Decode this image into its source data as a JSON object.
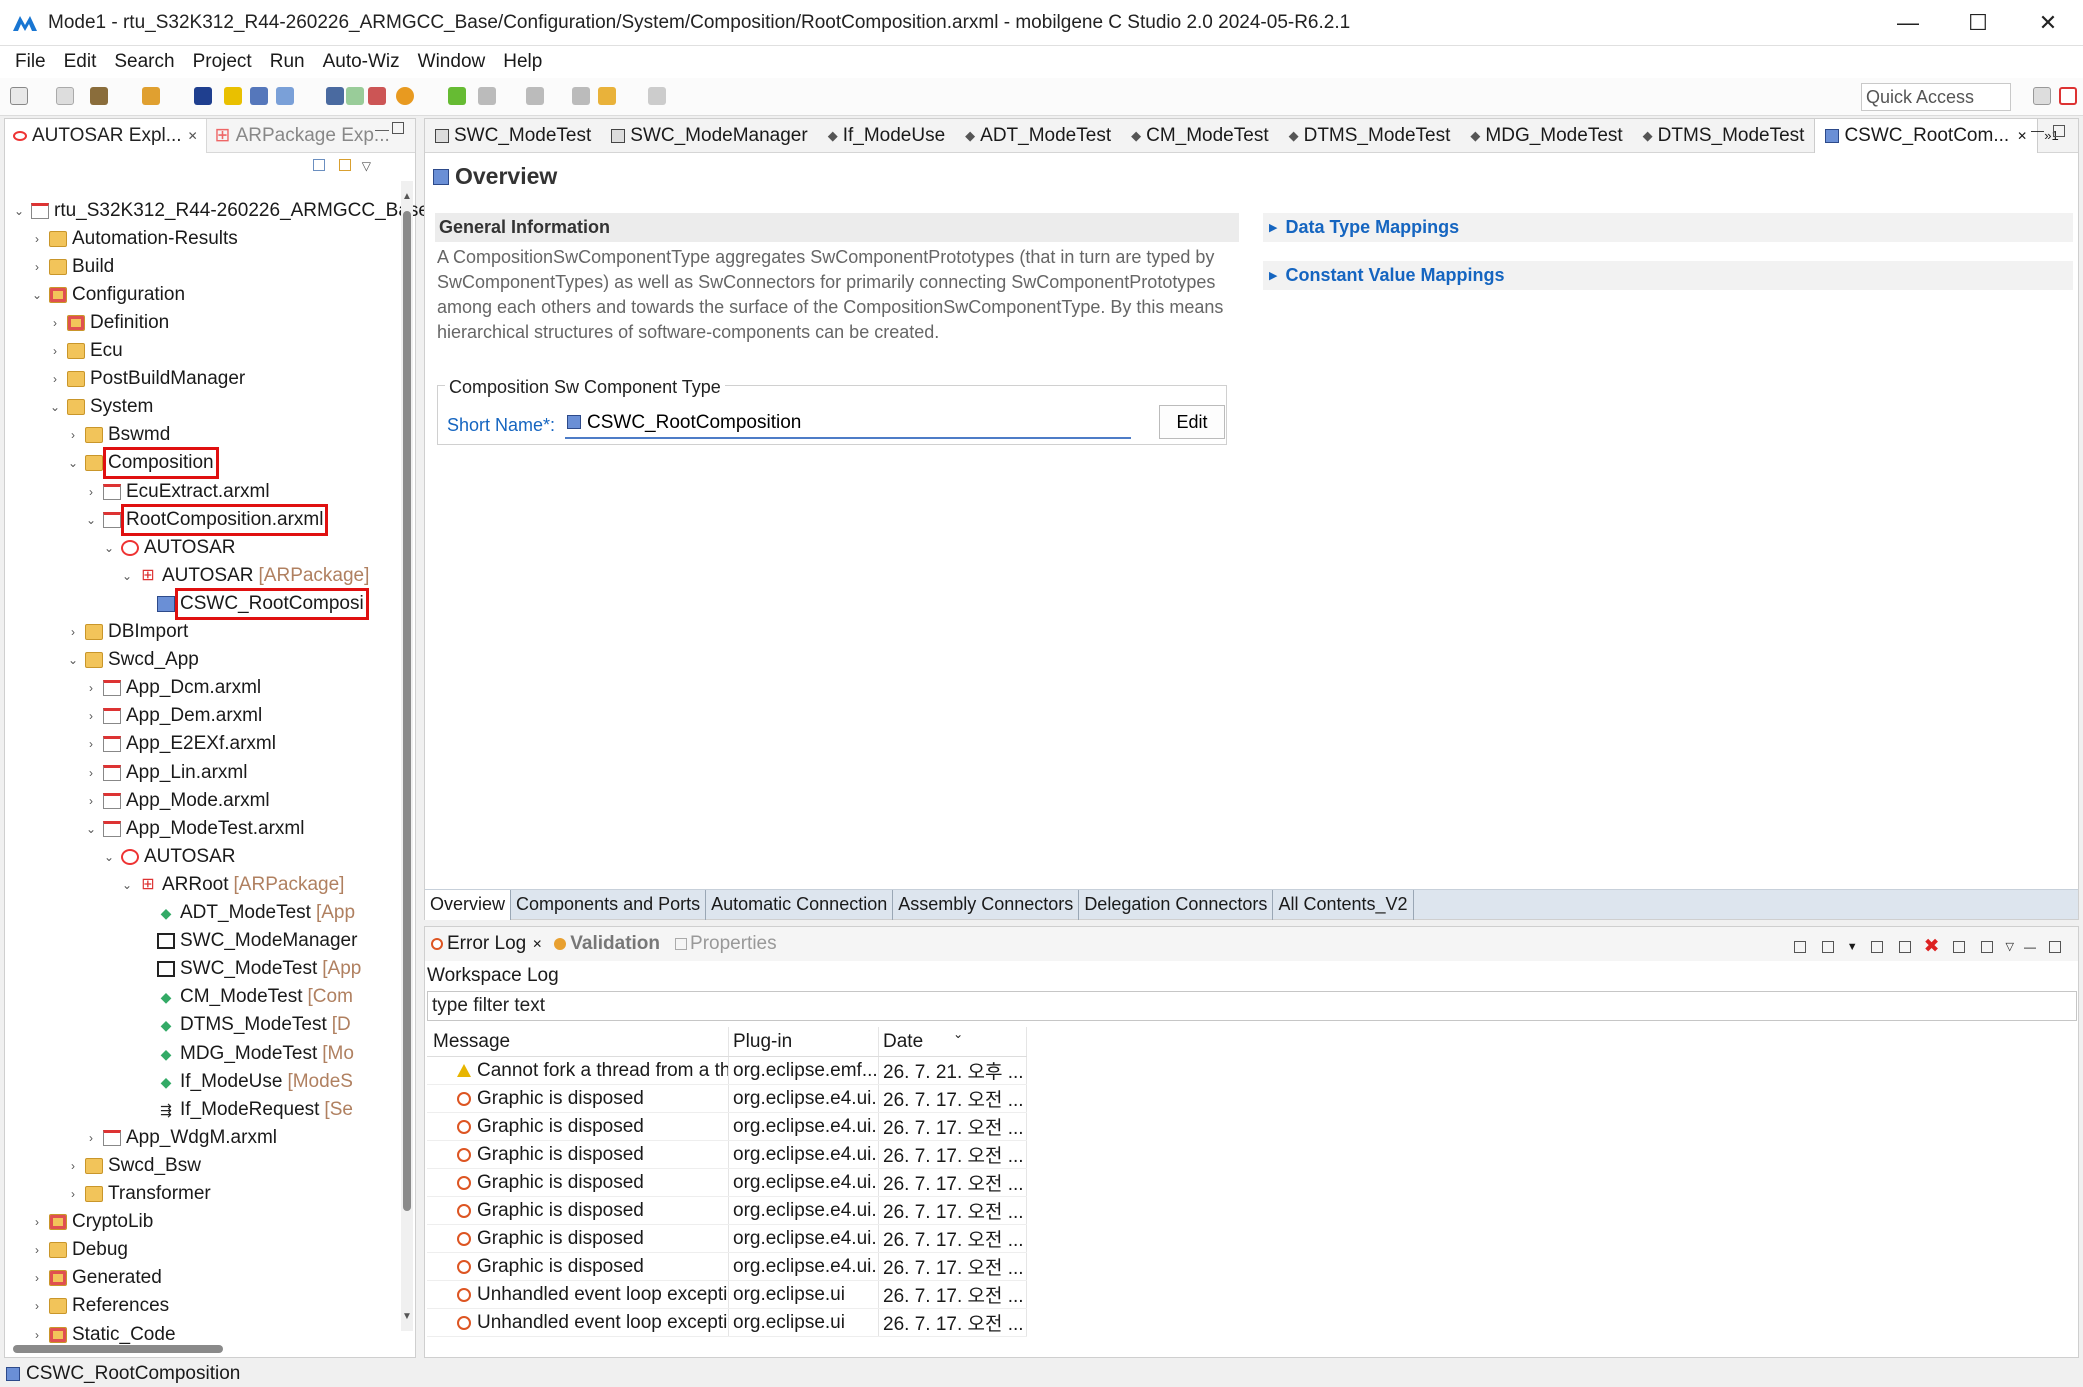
{
  "window": {
    "title": "Mode1 - rtu_S32K312_R44-260226_ARMGCC_Base/Configuration/System/Composition/RootComposition.arxml - mobilgene C Studio 2.0 2024-05-R6.2.1",
    "minimize": "—",
    "maximize": "☐",
    "close": "✕"
  },
  "menu": [
    "File",
    "Edit",
    "Search",
    "Project",
    "Run",
    "Auto-Wiz",
    "Window",
    "Help"
  ],
  "toolbar": {
    "quick_access": "Quick Access"
  },
  "left_panel": {
    "tabs": [
      {
        "label": "AUTOSAR Expl...",
        "active": true
      },
      {
        "label": "ARPackage Exp...",
        "active": false
      }
    ],
    "tree": [
      {
        "label": "rtu_S32K312_R44-260226_ARMGCC_Base",
        "depth": 0,
        "arrow": "⌄",
        "icon": "project-icon"
      },
      {
        "label": "Automation-Results",
        "depth": 1,
        "arrow": "›",
        "icon": "folder-icon"
      },
      {
        "label": "Build",
        "depth": 1,
        "arrow": "›",
        "icon": "folder-icon"
      },
      {
        "label": "Configuration",
        "depth": 1,
        "arrow": "⌄",
        "icon": "folder-red-icon"
      },
      {
        "label": "Definition",
        "depth": 2,
        "arrow": "›",
        "icon": "folder-red-icon"
      },
      {
        "label": "Ecu",
        "depth": 2,
        "arrow": "›",
        "icon": "folder-icon"
      },
      {
        "label": "PostBuildManager",
        "depth": 2,
        "arrow": "›",
        "icon": "folder-icon"
      },
      {
        "label": "System",
        "depth": 2,
        "arrow": "⌄",
        "icon": "folder-icon"
      },
      {
        "label": "Bswmd",
        "depth": 3,
        "arrow": "›",
        "icon": "folder-icon"
      },
      {
        "label": "Composition",
        "depth": 3,
        "arrow": "⌄",
        "icon": "folder-icon",
        "highlight": true
      },
      {
        "label": "EcuExtract.arxml",
        "depth": 4,
        "arrow": "›",
        "icon": "file-icon"
      },
      {
        "label": "RootComposition.arxml",
        "depth": 4,
        "arrow": "⌄",
        "icon": "file-icon",
        "highlight": true
      },
      {
        "label": "AUTOSAR",
        "depth": 5,
        "arrow": "⌄",
        "icon": "autosar-icon"
      },
      {
        "label": "AUTOSAR",
        "suffix": "[ARPackage]",
        "depth": 6,
        "arrow": "⌄",
        "icon": "package-icon"
      },
      {
        "label": "CSWC_RootComposi",
        "depth": 7,
        "arrow": "",
        "icon": "composition-icon",
        "highlight": true
      },
      {
        "label": "DBImport",
        "depth": 3,
        "arrow": "›",
        "icon": "folder-icon"
      },
      {
        "label": "Swcd_App",
        "depth": 3,
        "arrow": "⌄",
        "icon": "folder-icon"
      },
      {
        "label": "App_Dcm.arxml",
        "depth": 4,
        "arrow": "›",
        "icon": "file-icon"
      },
      {
        "label": "App_Dem.arxml",
        "depth": 4,
        "arrow": "›",
        "icon": "file-icon"
      },
      {
        "label": "App_E2EXf.arxml",
        "depth": 4,
        "arrow": "›",
        "icon": "file-icon"
      },
      {
        "label": "App_Lin.arxml",
        "depth": 4,
        "arrow": "›",
        "icon": "file-icon"
      },
      {
        "label": "App_Mode.arxml",
        "depth": 4,
        "arrow": "›",
        "icon": "file-icon"
      },
      {
        "label": "App_ModeTest.arxml",
        "depth": 4,
        "arrow": "⌄",
        "icon": "file-icon"
      },
      {
        "label": "AUTOSAR",
        "depth": 5,
        "arrow": "⌄",
        "icon": "autosar-icon"
      },
      {
        "label": "ARRoot",
        "suffix": "[ARPackage]",
        "depth": 6,
        "arrow": "⌄",
        "icon": "package-icon"
      },
      {
        "label": "ADT_ModeTest",
        "suffix": "[App",
        "depth": 7,
        "arrow": "",
        "icon": "port-icon"
      },
      {
        "label": "SWC_ModeManager",
        "depth": 7,
        "arrow": "",
        "icon": "swc-icon"
      },
      {
        "label": "SWC_ModeTest",
        "suffix": "[App",
        "depth": 7,
        "arrow": "",
        "icon": "swc-icon"
      },
      {
        "label": "CM_ModeTest",
        "suffix": "[Com",
        "depth": 7,
        "arrow": "",
        "icon": "port-icon"
      },
      {
        "label": "DTMS_ModeTest",
        "suffix": "[D",
        "depth": 7,
        "arrow": "",
        "icon": "port-icon"
      },
      {
        "label": "MDG_ModeTest",
        "suffix": "[Mo",
        "depth": 7,
        "arrow": "",
        "icon": "port-icon"
      },
      {
        "label": "If_ModeUse",
        "suffix": "[ModeS",
        "depth": 7,
        "arrow": "",
        "icon": "port-icon"
      },
      {
        "label": "If_ModeRequest",
        "suffix": "[Se",
        "depth": 7,
        "arrow": "",
        "icon": "interface-icon"
      },
      {
        "label": "App_WdgM.arxml",
        "depth": 4,
        "arrow": "›",
        "icon": "file-icon"
      },
      {
        "label": "Swcd_Bsw",
        "depth": 3,
        "arrow": "›",
        "icon": "folder-icon"
      },
      {
        "label": "Transformer",
        "depth": 3,
        "arrow": "›",
        "icon": "folder-icon"
      },
      {
        "label": "CryptoLib",
        "depth": 1,
        "arrow": "›",
        "icon": "folder-red-icon"
      },
      {
        "label": "Debug",
        "depth": 1,
        "arrow": "›",
        "icon": "folder-icon"
      },
      {
        "label": "Generated",
        "depth": 1,
        "arrow": "›",
        "icon": "folder-red-icon"
      },
      {
        "label": "References",
        "depth": 1,
        "arrow": "›",
        "icon": "folder-icon"
      },
      {
        "label": "Static_Code",
        "depth": 1,
        "arrow": "›",
        "icon": "folder-red-icon"
      }
    ]
  },
  "editor": {
    "tabs": [
      {
        "label": "SWC_ModeTest",
        "icon": "swc-icon"
      },
      {
        "label": "SWC_ModeManager",
        "icon": "swc-icon"
      },
      {
        "label": "If_ModeUse",
        "icon": "port-icon"
      },
      {
        "label": "ADT_ModeTest",
        "icon": "port-icon"
      },
      {
        "label": "CM_ModeTest",
        "icon": "port-icon"
      },
      {
        "label": "DTMS_ModeTest",
        "icon": "port-icon"
      },
      {
        "label": "MDG_ModeTest",
        "icon": "port-icon"
      },
      {
        "label": "DTMS_ModeTest",
        "icon": "port-icon"
      },
      {
        "label": "CSWC_RootCom...",
        "icon": "composition-icon",
        "active": true
      }
    ],
    "overflow": "»1",
    "overview_title": "Overview",
    "general_info": {
      "header": "General Information",
      "description": "A CompositionSwComponentType aggregates SwComponentPrototypes (that in turn are typed by SwComponentTypes) as well as SwConnectors for primarily connecting SwComponentPrototypes among each others and towards the surface of the CompositionSwComponentType. By this means hierarchical structures of software-components can be created."
    },
    "group_title": "Composition Sw Component Type",
    "short_name_label": "Short Name*:",
    "short_name_value": "CSWC_RootComposition",
    "edit_button": "Edit",
    "data_type_mappings": "Data Type Mappings",
    "constant_value_mappings": "Constant Value Mappings",
    "page_tabs": [
      {
        "label": "Overview",
        "active": true
      },
      {
        "label": "Components and Ports"
      },
      {
        "label": "Automatic Connection"
      },
      {
        "label": "Assembly Connectors"
      },
      {
        "label": "Delegation Connectors"
      },
      {
        "label": "All Contents_V2"
      }
    ]
  },
  "log_panel": {
    "tabs": [
      {
        "label": "Error Log",
        "style": "active"
      },
      {
        "label": "Validation",
        "style": "semi"
      },
      {
        "label": "Properties",
        "style": "inactive"
      }
    ],
    "workspace_label": "Workspace Log",
    "filter_value": "type filter text",
    "columns": [
      "Message",
      "Plug-in",
      "Date"
    ],
    "rows": [
      {
        "level": "warning",
        "message": "Cannot fork a thread from a th",
        "plugin": "org.eclipse.emf....",
        "date": "26. 7. 21. 오후 ..."
      },
      {
        "level": "error",
        "message": "Graphic is disposed",
        "plugin": "org.eclipse.e4.ui...",
        "date": "26. 7. 17. 오전 ..."
      },
      {
        "level": "error",
        "message": "Graphic is disposed",
        "plugin": "org.eclipse.e4.ui...",
        "date": "26. 7. 17. 오전 ..."
      },
      {
        "level": "error",
        "message": "Graphic is disposed",
        "plugin": "org.eclipse.e4.ui...",
        "date": "26. 7. 17. 오전 ..."
      },
      {
        "level": "error",
        "message": "Graphic is disposed",
        "plugin": "org.eclipse.e4.ui...",
        "date": "26. 7. 17. 오전 ..."
      },
      {
        "level": "error",
        "message": "Graphic is disposed",
        "plugin": "org.eclipse.e4.ui...",
        "date": "26. 7. 17. 오전 ..."
      },
      {
        "level": "error",
        "message": "Graphic is disposed",
        "plugin": "org.eclipse.e4.ui...",
        "date": "26. 7. 17. 오전 ..."
      },
      {
        "level": "error",
        "message": "Graphic is disposed",
        "plugin": "org.eclipse.e4.ui...",
        "date": "26. 7. 17. 오전 ..."
      },
      {
        "level": "error",
        "message": "Unhandled event loop exceptic",
        "plugin": "org.eclipse.ui",
        "date": "26. 7. 17. 오전 ..."
      },
      {
        "level": "error",
        "message": "Unhandled event loop exceptic",
        "plugin": "org.eclipse.ui",
        "date": "26. 7. 17. 오전 ..."
      }
    ]
  },
  "status_bar": {
    "text": "CSWC_RootComposition"
  }
}
